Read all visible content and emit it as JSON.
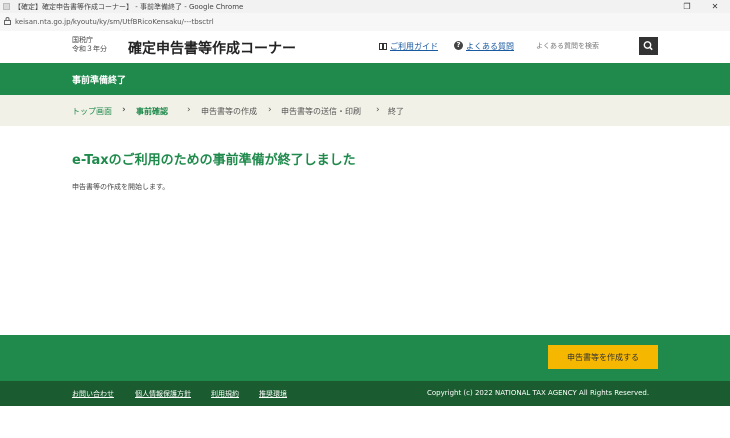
{
  "browser": {
    "window_title": "【確定】確定申告書等作成コーナー】 - 事前準備終了 - Google Chrome",
    "url": "keisan.nta.go.jp/kyoutu/ky/sm/UtfBRicoKensaku/---tbsctrl"
  },
  "header": {
    "org_line1": "国税庁",
    "org_line2": "令和３年分",
    "title": "確定申告書等作成コーナー",
    "guide_label": "ご利用ガイド",
    "faq_label": "よくある質問",
    "search_placeholder": "よくある質問を検索"
  },
  "page_title_bar": "事前準備終了",
  "breadcrumb": [
    {
      "label": "トップ画面"
    },
    {
      "label": "事前確認"
    },
    {
      "label": "申告書等の作成"
    },
    {
      "label": "申告書等の送信・印刷"
    },
    {
      "label": "終了"
    }
  ],
  "main": {
    "heading": "e-Taxのご利用のための事前準備が終了しました",
    "message": "申告書等の作成を開始します。"
  },
  "action": {
    "start_button": "申告書等を作成する"
  },
  "footer": {
    "links": [
      "お問い合わせ",
      "個人情報保護方針",
      "利用規約",
      "推奨環境"
    ],
    "copyright": "Copyright (c) 2022 NATIONAL TAX AGENCY All Rights Reserved."
  },
  "colors": {
    "primary_green": "#1f8a4c",
    "footer_green": "#1a5c2f",
    "breadcrumb_bg": "#f2f1e7",
    "button_yellow": "#f5b700"
  }
}
